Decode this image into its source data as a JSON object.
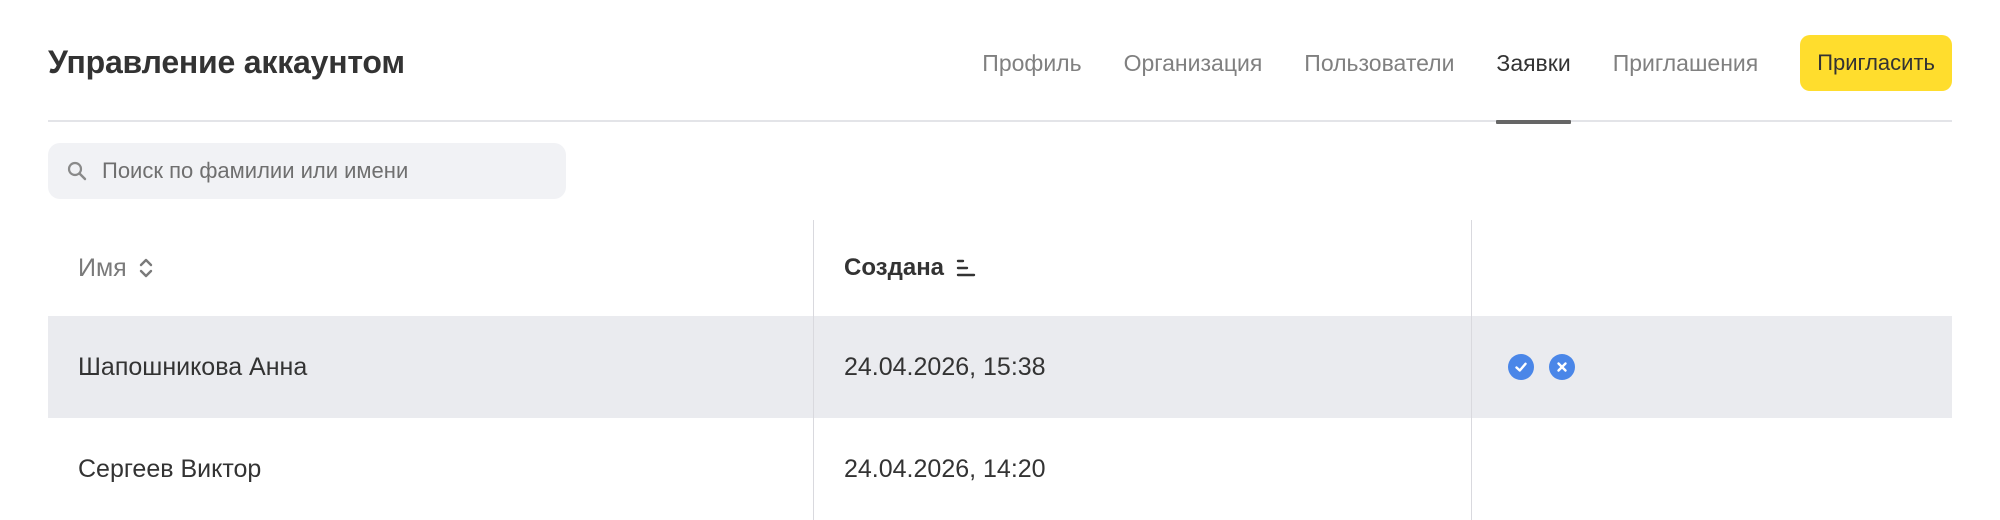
{
  "header": {
    "title": "Управление аккаунтом"
  },
  "nav": {
    "tabs": [
      {
        "label": "Профиль",
        "active": false
      },
      {
        "label": "Организация",
        "active": false
      },
      {
        "label": "Пользователи",
        "active": false
      },
      {
        "label": "Заявки",
        "active": true
      },
      {
        "label": "Приглашения",
        "active": false
      }
    ],
    "invite_label": "Пригласить"
  },
  "search": {
    "placeholder": "Поиск по фамилии или имени",
    "value": ""
  },
  "table": {
    "columns": {
      "name": "Имя",
      "created": "Создана",
      "actions": ""
    },
    "rows": [
      {
        "name": "Шапошникова Анна",
        "created": "24.04.2026, 15:38",
        "highlighted": true,
        "actions": [
          "approve-icon",
          "reject-icon"
        ]
      },
      {
        "name": "Сергеев Виктор",
        "created": "24.04.2026, 14:20",
        "highlighted": false,
        "actions": []
      }
    ]
  },
  "colors": {
    "accent_yellow": "#ffdd2d",
    "action_blue": "#4a86e8",
    "row_highlight": "#eaebef"
  }
}
